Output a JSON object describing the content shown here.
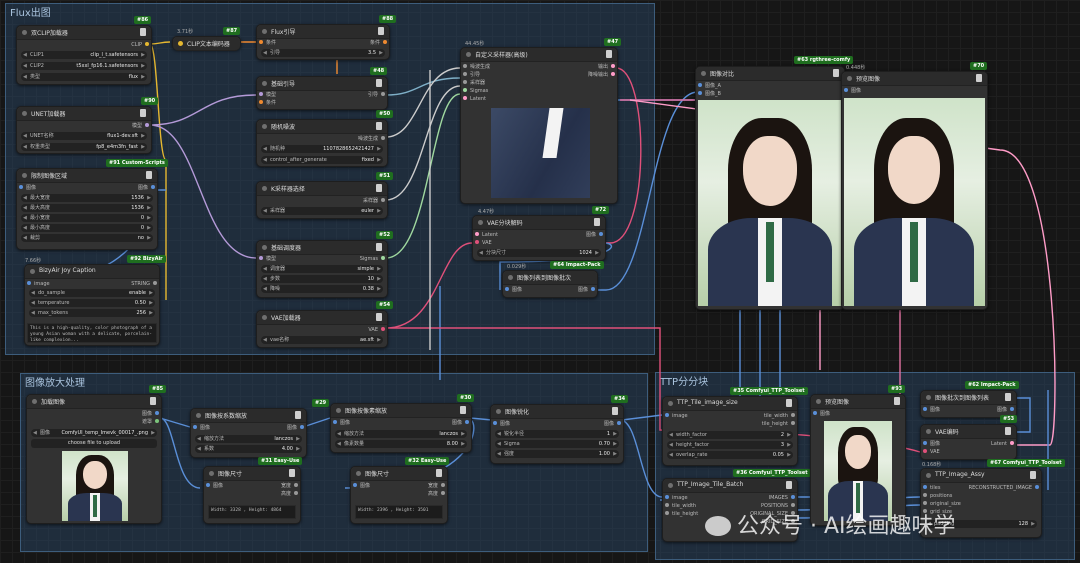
{
  "groups": {
    "flux": "Flux出图",
    "upscale": "图像放大处理",
    "ttp": "TTP分分块"
  },
  "nodes": {
    "dualclip": {
      "badge": "#86",
      "title": "双CLIP加载器",
      "out": "CLIP",
      "w1l": "CLIP1",
      "w1v": "clip_l_t.safetensors",
      "w2l": "CLIP2",
      "w2v": "t5xxl_fp16.1.safetensors",
      "w3l": "类型",
      "w3v": "flux"
    },
    "cliptext": {
      "badge": "#87",
      "time": "3.71秒",
      "title": "CLIP文本编码器"
    },
    "fluxguide": {
      "badge": "#88",
      "title": "Flux引导",
      "in": "条件",
      "out": "条件",
      "w1l": "引导",
      "w1v": "3.5"
    },
    "basicguider": {
      "badge": "#48",
      "title": "基础引导",
      "in1": "模型",
      "in2": "条件",
      "out": "引导"
    },
    "unet": {
      "badge": "#90",
      "title": "UNET加载器",
      "out": "模型",
      "w1l": "UNET名称",
      "w1v": "flux1-dev.sft",
      "w2l": "权重类型",
      "w2v": "fp8_e4m3fn_fast"
    },
    "noise": {
      "badge": "#50",
      "title": "随机噪波",
      "out": "噪波生成",
      "w1l": "随机种",
      "w1v": "1107828652421427",
      "w2l": "control_after_generate",
      "w2v": "fixed"
    },
    "ksampler": {
      "badge": "#51",
      "title": "K采样器选择",
      "out": "采样器",
      "w1l": "采样器",
      "w1v": "euler"
    },
    "scheduler": {
      "badge": "#52",
      "title": "基础调度器",
      "in": "模型",
      "out": "Sigmas",
      "w1l": "调度器",
      "w1v": "simple",
      "w2l": "步数",
      "w2v": "10",
      "w3l": "降噪",
      "w3v": "0.38"
    },
    "vaeload": {
      "badge": "#54",
      "title": "VAE加载器",
      "out": "VAE",
      "w1l": "vae名称",
      "w1v": "ae.sft"
    },
    "cropimg": {
      "badge": "#91 Custom-Scripts",
      "title": "限制图像区域",
      "in": "图像",
      "out": "图像",
      "w": [
        [
          "最大宽度",
          "1536"
        ],
        [
          "最大高度",
          "1536"
        ],
        [
          "最小宽度",
          "0"
        ],
        [
          "最小高度",
          "0"
        ],
        [
          "裁剪",
          "no"
        ]
      ]
    },
    "joycap": {
      "badge": "#92 BizyAir",
      "time": "7.66秒",
      "title": "BizyAir Joy Caption",
      "in": "image",
      "out": "STRING",
      "w": [
        [
          "do_sample",
          "enable"
        ],
        [
          "temperature",
          "0.50"
        ],
        [
          "max_tokens",
          "256"
        ]
      ],
      "text": "This is a high-quality, color photograph of a young Asian woman with a delicate, porcelain-like complexion..."
    },
    "customsampler": {
      "badge": "#47",
      "time": "44.45秒",
      "title": "自定义采样器(高级)",
      "ins": [
        "噪波生成",
        "引导",
        "采样器",
        "Sigmas",
        "Latent"
      ],
      "outs": [
        "输出",
        "降噪输出"
      ]
    },
    "vaedecode": {
      "badge": "#72",
      "time": "4.47秒",
      "title": "VAE分块解码",
      "ins": [
        "Latent",
        "VAE"
      ],
      "out": "图像",
      "w1l": "分块尺寸",
      "w1v": "1024"
    },
    "imglist": {
      "badge": "#64 Impact-Pack",
      "time": "0.029秒",
      "title": "图像列表到图像批次",
      "in": "图像",
      "out": "图像"
    },
    "compare": {
      "badge": "#63 rgthree-comfy",
      "title": "图像对比",
      "ins": [
        "图像_A",
        "图像_B"
      ]
    },
    "preview": {
      "badge": "#70",
      "time": "0.448秒",
      "title": "预览图像",
      "in": "图像"
    },
    "loadimg": {
      "badge": "#85",
      "title": "加载图像",
      "outs": [
        "图像",
        "遮罩"
      ],
      "w1l": "图像",
      "w1v": "ComfyUI_temp_Imevk_00017_.png",
      "btn": "choose file to upload"
    },
    "scale1": {
      "badge": "#29",
      "title": "图像按系数缩放",
      "in": "图像",
      "out": "图像",
      "w1l": "缩放方法",
      "w1v": "lanczos",
      "w2l": "系数",
      "w2v": "4.00"
    },
    "scale2": {
      "badge": "#30",
      "title": "图像按像素缩放",
      "in": "图像",
      "out": "图像",
      "w1l": "缩放方法",
      "w1v": "lanczos",
      "w2l": "像素数量",
      "w2v": "8.00"
    },
    "sharpen": {
      "badge": "#34",
      "title": "图像锐化",
      "in": "图像",
      "out": "图像",
      "w1l": "锐化半径",
      "w1v": "1",
      "w2l": "Sigma",
      "w2v": "0.70",
      "w3l": "强度",
      "w3v": "1.00"
    },
    "size1": {
      "badge": "#31 Easy-Use",
      "title": "图像尺寸",
      "in": "图像",
      "outs": [
        "宽度",
        "高度"
      ],
      "text": "Width: 3328 , Height: 4864"
    },
    "size2": {
      "badge": "#32 Easy-Use",
      "title": "图像尺寸",
      "in": "图像",
      "outs": [
        "宽度",
        "高度"
      ],
      "text": "Width: 2396 , Height: 3501"
    },
    "ttpsize": {
      "badge": "#35 Comfyui_TTP_Toolset",
      "title": "TTP_Tile_image_size",
      "in": "image",
      "outs": [
        "tile_width",
        "tile_height"
      ],
      "w": [
        [
          "width_factor",
          "2"
        ],
        [
          "height_factor",
          "3"
        ],
        [
          "overlap_rate",
          "0.05"
        ]
      ]
    },
    "ttpbatch": {
      "badge": "#36 Comfyui_TTP_Toolset",
      "title": "TTP_Image_Tile_Batch",
      "ins": [
        "image",
        "tile_width",
        "tile_height"
      ],
      "outs": [
        "IMAGES",
        "POSITIONS",
        "ORIGINAL_SIZE",
        "GRID_SIZE"
      ]
    },
    "preview2": {
      "badge": "#93",
      "title": "预览图像",
      "in": "图像"
    },
    "img2list": {
      "badge": "#62 Impact-Pack",
      "title": "图像批次到图像列表",
      "in": "图像",
      "out": "图像"
    },
    "vaeenc": {
      "badge": "#53",
      "title": "VAE编码",
      "ins": [
        "图像",
        "VAE"
      ],
      "out": "Latent"
    },
    "ttpassy": {
      "badge": "#67 Comfyui_TTP_Toolset",
      "time": "0.168秒",
      "title": "TTP_Image_Assy",
      "ins": [
        "tiles",
        "positions",
        "original_size",
        "grid_size"
      ],
      "out": "RECONSTRUCTED_IMAGE",
      "w1l": "padding",
      "w1v": "128"
    }
  },
  "watermark": "公众号 · AI绘画趣味学"
}
